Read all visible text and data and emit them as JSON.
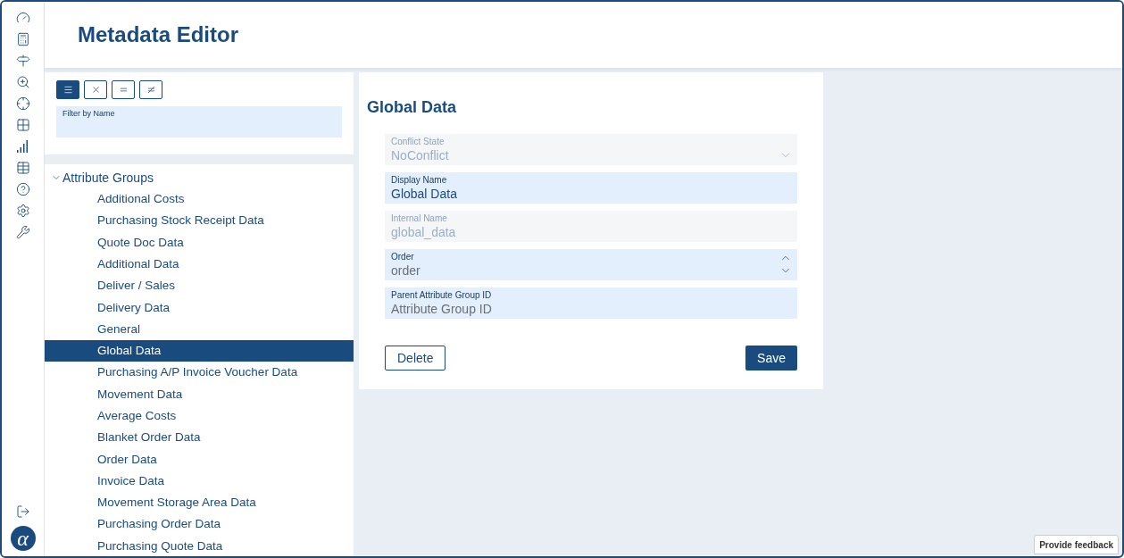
{
  "header": {
    "title": "Metadata Editor"
  },
  "filter": {
    "modes": [
      {
        "kind": "lines",
        "selected": true
      },
      {
        "kind": "cross",
        "selected": false
      },
      {
        "kind": "equal",
        "selected": false
      },
      {
        "kind": "not_equal",
        "selected": false
      }
    ],
    "field": {
      "label": "Filter by Name"
    }
  },
  "tree": {
    "label": "Attribute Groups",
    "expanded": true,
    "children": [
      {
        "label": "Additional Costs",
        "selected": false
      },
      {
        "label": "Purchasing Stock Receipt Data",
        "selected": false
      },
      {
        "label": "Quote Doc Data",
        "selected": false
      },
      {
        "label": "Additional Data",
        "selected": false
      },
      {
        "label": "Deliver / Sales",
        "selected": false
      },
      {
        "label": "Delivery Data",
        "selected": false
      },
      {
        "label": "General",
        "selected": false
      },
      {
        "label": "Global Data",
        "selected": true
      },
      {
        "label": "Purchasing A/P Invoice Voucher Data",
        "selected": false
      },
      {
        "label": "Movement Data",
        "selected": false
      },
      {
        "label": "Average Costs",
        "selected": false
      },
      {
        "label": "Blanket Order Data",
        "selected": false
      },
      {
        "label": "Order Data",
        "selected": false
      },
      {
        "label": "Invoice Data",
        "selected": false
      },
      {
        "label": "Movement Storage Area Data",
        "selected": false
      },
      {
        "label": "Purchasing Order Data",
        "selected": false
      },
      {
        "label": "Purchasing Quote Data",
        "selected": false
      }
    ]
  },
  "form": {
    "title": "Global Data",
    "fields": [
      {
        "kind": "select",
        "label": "Conflict State",
        "value": "NoConflict",
        "disabled": true
      },
      {
        "kind": "text",
        "label": "Display Name",
        "value": "Global Data",
        "disabled": false
      },
      {
        "kind": "text",
        "label": "Internal Name",
        "value": "global_data",
        "disabled": true
      },
      {
        "kind": "number",
        "label": "Order",
        "placeholder": "order",
        "disabled": false
      },
      {
        "kind": "text",
        "label": "Parent Attribute Group ID",
        "placeholder": "Attribute Group ID",
        "disabled": false
      }
    ],
    "buttons": [
      {
        "kind": "secondary",
        "label": "Delete"
      },
      {
        "kind": "primary",
        "label": "Save"
      }
    ]
  },
  "logo": {
    "text": "α"
  },
  "feedback": {
    "label": "Provide feedback"
  }
}
